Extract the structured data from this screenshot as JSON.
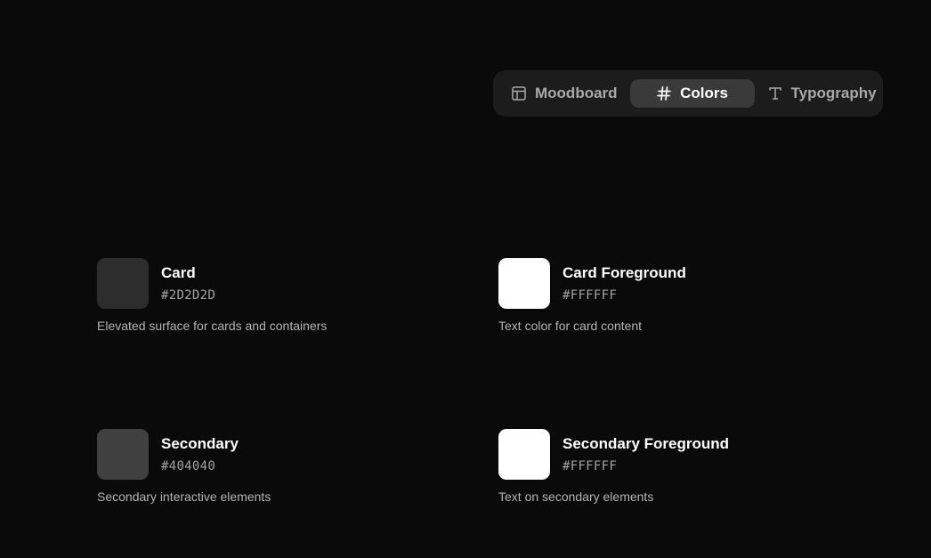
{
  "tabs": [
    {
      "label": "Moodboard",
      "icon": "layout-icon",
      "active": false
    },
    {
      "label": "Colors",
      "icon": "hash-icon",
      "active": true
    },
    {
      "label": "Typography",
      "icon": "type-icon",
      "active": false
    }
  ],
  "colors": [
    {
      "name": "Card",
      "hex": "#2D2D2D",
      "description": "Elevated surface for cards and containers",
      "swatch": "#2d2d2d"
    },
    {
      "name": "Card Foreground",
      "hex": "#FFFFFF",
      "description": "Text color for card content",
      "swatch": "#ffffff"
    },
    {
      "name": "Secondary",
      "hex": "#404040",
      "description": "Secondary interactive elements",
      "swatch": "#404040"
    },
    {
      "name": "Secondary Foreground",
      "hex": "#FFFFFF",
      "description": "Text on secondary elements",
      "swatch": "#ffffff"
    }
  ],
  "theme": {
    "background": "#0a0a0a",
    "tab_bar": "#1c1c1c",
    "tab_active": "#3a3a3a"
  }
}
